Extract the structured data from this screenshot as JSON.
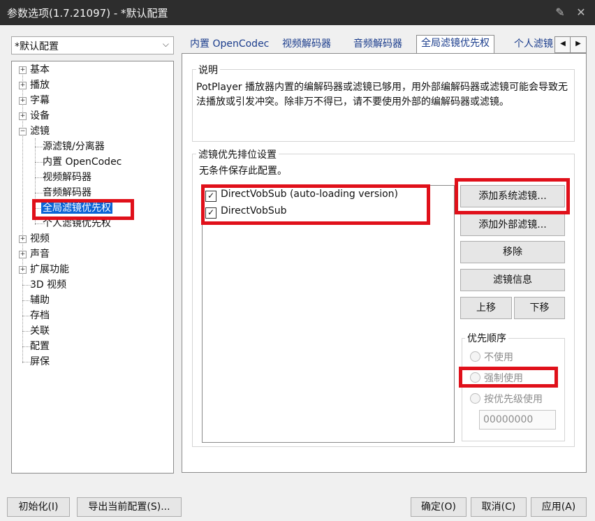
{
  "window": {
    "title": "参数选项(1.7.21097) - *默认配置"
  },
  "profile": {
    "value": "*默认配置"
  },
  "tree": {
    "items": [
      {
        "label": "基本"
      },
      {
        "label": "播放"
      },
      {
        "label": "字幕"
      },
      {
        "label": "设备"
      },
      {
        "label": "滤镜"
      },
      {
        "label": "源滤镜/分离器"
      },
      {
        "label": "内置 OpenCodec"
      },
      {
        "label": "视频解码器"
      },
      {
        "label": "音频解码器"
      },
      {
        "label": "全局滤镜优先权"
      },
      {
        "label": "个人滤镜优先权"
      },
      {
        "label": "视频"
      },
      {
        "label": "声音"
      },
      {
        "label": "扩展功能"
      },
      {
        "label": "3D 视频"
      },
      {
        "label": "辅助"
      },
      {
        "label": "存档"
      },
      {
        "label": "关联"
      },
      {
        "label": "配置"
      },
      {
        "label": "屏保"
      }
    ]
  },
  "tabs": [
    {
      "label": "内置 OpenCodec"
    },
    {
      "label": "视频解码器"
    },
    {
      "label": "音频解码器"
    },
    {
      "label": "全局滤镜优先权"
    },
    {
      "label": "个人滤镜"
    }
  ],
  "description": {
    "label": "说明",
    "text": "PotPlayer 播放器内置的编解码器或滤镜已够用，用外部编解码器或滤镜可能会导致无法播放或引发冲突。除非万不得已，请不要使用外部的编解码器或滤镜。"
  },
  "priority": {
    "label": "滤镜优先排位设置",
    "note": "无条件保存此配置。",
    "filters": [
      {
        "name": "DirectVobSub (auto-loading version)",
        "checked": true
      },
      {
        "name": "DirectVobSub",
        "checked": true
      }
    ],
    "buttons": {
      "add_system": "添加系统滤镜...",
      "add_external": "添加外部滤镜...",
      "remove": "移除",
      "info": "滤镜信息",
      "up": "上移",
      "down": "下移"
    },
    "order": {
      "label": "优先顺序",
      "options": [
        "不使用",
        "强制使用",
        "按优先级使用"
      ],
      "value": "00000000"
    }
  },
  "footer": {
    "init": "初始化(I)",
    "export": "导出当前配置(S)...",
    "ok": "确定(O)",
    "cancel": "取消(C)",
    "apply": "应用(A)"
  }
}
